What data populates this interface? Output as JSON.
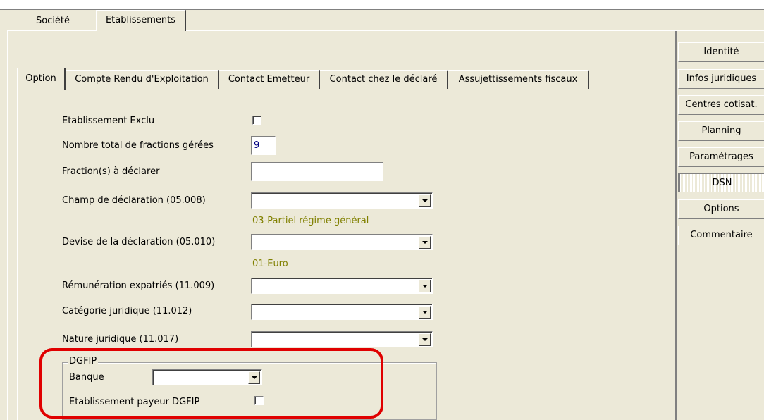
{
  "top_tabs": [
    {
      "label": "Société",
      "active": false
    },
    {
      "label": "Etablissements",
      "active": true
    }
  ],
  "sub_tabs": [
    {
      "label": "Option",
      "active": true
    },
    {
      "label": "Compte Rendu d'Exploitation",
      "active": false
    },
    {
      "label": "Contact Emetteur",
      "active": false
    },
    {
      "label": "Contact chez le déclaré",
      "active": false
    },
    {
      "label": "Assujettissements fiscaux",
      "active": false
    }
  ],
  "form": {
    "etablissement_exclu": {
      "label": "Etablissement Exclu",
      "checked": false
    },
    "nombre_fractions": {
      "label": "Nombre total de fractions gérées",
      "value": "9"
    },
    "fractions_declarer": {
      "label": "Fraction(s) à déclarer",
      "value": ""
    },
    "champ_declaration": {
      "label": "Champ de déclaration (05.008)",
      "value": "",
      "hint": "03-Partiel régime général"
    },
    "devise_declaration": {
      "label": "Devise de la déclaration (05.010)",
      "value": "",
      "hint": "01-Euro"
    },
    "remuneration_expatries": {
      "label": "Rémunération expatriés (11.009)",
      "value": ""
    },
    "categorie_juridique": {
      "label": "Catégorie juridique (11.012)",
      "value": ""
    },
    "nature_juridique": {
      "label": "Nature juridique (11.017)",
      "value": ""
    }
  },
  "dgfip": {
    "title": "DGFIP",
    "banque": {
      "label": "Banque",
      "value": ""
    },
    "payeur": {
      "label": "Etablissement payeur DGFIP",
      "checked": false
    }
  },
  "right_nav": [
    {
      "label": "Identité",
      "active": false
    },
    {
      "label": "Infos juridiques",
      "active": false
    },
    {
      "label": "Centres cotisat.",
      "active": false
    },
    {
      "label": "Planning",
      "active": false
    },
    {
      "label": "Paramétrages",
      "active": false
    },
    {
      "label": "DSN",
      "active": true
    },
    {
      "label": "Options",
      "active": false
    },
    {
      "label": "Commentaire",
      "active": false
    }
  ],
  "colors": {
    "window_bg": "#ece9d8",
    "hint_text": "#808000",
    "highlight": "#e00000",
    "value_text": "#000080"
  }
}
